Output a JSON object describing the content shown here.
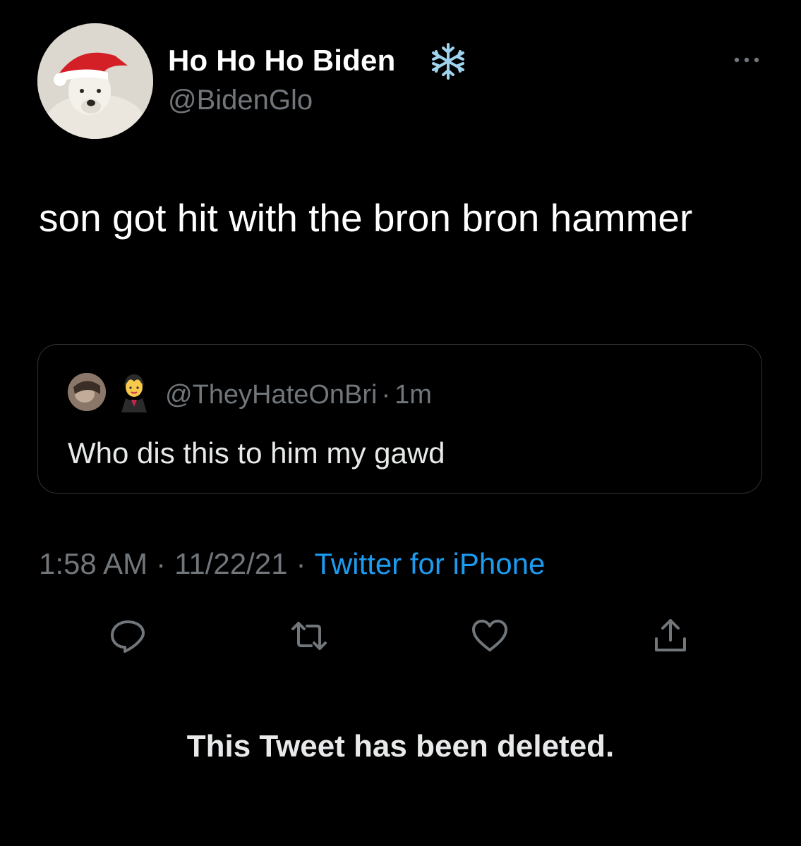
{
  "tweet": {
    "author": {
      "display_name": "Ho Ho Ho Biden",
      "handle": "@BidenGlo",
      "name_emoji_icon": "snowflake-icon",
      "avatar": "polar-bear-santa-hat-avatar"
    },
    "text": "son got hit with the bron bron hammer",
    "quoted_tweet": {
      "avatar": "user-photo-avatar",
      "name_emoji_icon": "vampire-woman-icon",
      "handle": "@TheyHateOnBri",
      "separator": "·",
      "time": "1m",
      "text": "Who dis this to him my gawd"
    },
    "meta": {
      "time": "1:58 AM",
      "separator": "·",
      "date": "11/22/21",
      "source": "Twitter for iPhone"
    },
    "actions": [
      "reply-icon",
      "retweet-icon",
      "like-icon",
      "share-icon"
    ]
  },
  "deleted_notice": "This Tweet has been deleted.",
  "colors": {
    "background": "#000000",
    "text_primary": "#ffffff",
    "text_secondary": "#71767b",
    "link": "#1d9bf0",
    "border": "#2f3336"
  }
}
